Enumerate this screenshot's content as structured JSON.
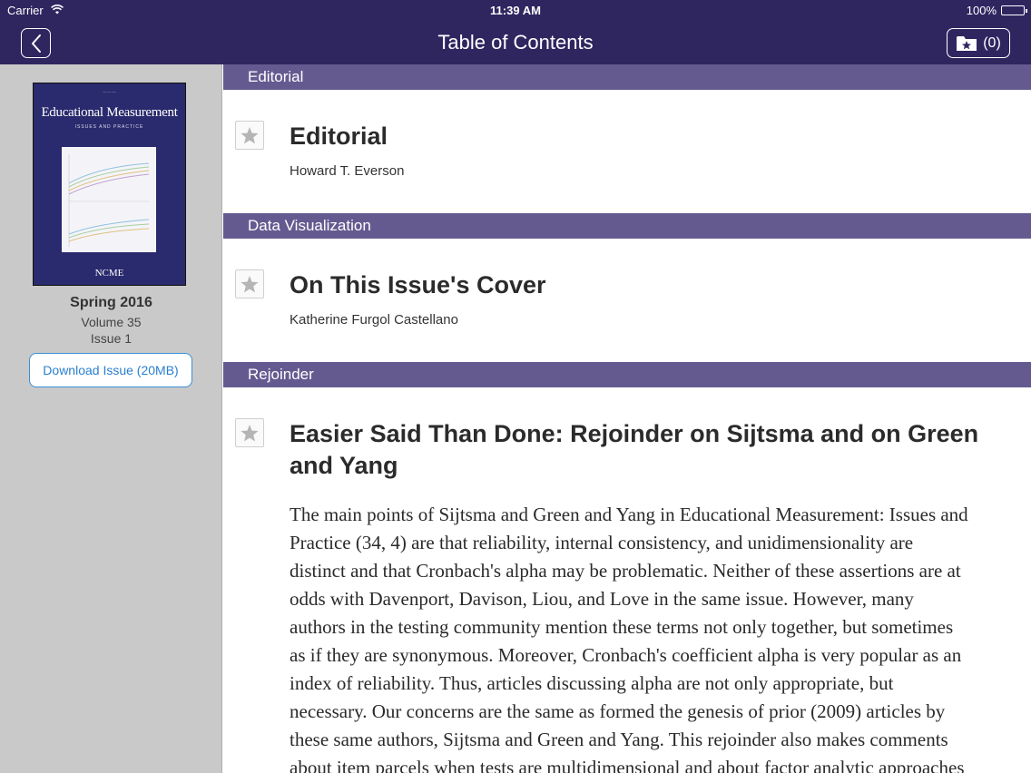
{
  "status_bar": {
    "carrier": "Carrier",
    "time": "11:39 AM",
    "battery": "100%"
  },
  "nav": {
    "title": "Table of Contents",
    "saved_count": "(0)"
  },
  "issue": {
    "cover": {
      "title": "Educational Measurement",
      "subtitle": "ISSUES AND PRACTICE",
      "logo": "NCME"
    },
    "season": "Spring 2016",
    "volume": "Volume 35",
    "number": "Issue 1",
    "download_label": "Download Issue (20MB)"
  },
  "sections": [
    {
      "header": "Editorial",
      "article": {
        "title": "Editorial",
        "author": "Howard T. Everson"
      }
    },
    {
      "header": "Data Visualization",
      "article": {
        "title": "On This Issue's Cover",
        "author": "Katherine Furgol Castellano"
      }
    },
    {
      "header": "Rejoinder",
      "article": {
        "title_line1": "Easier Said Than Done: Rejoinder on Sijtsma and on Green",
        "title_line2": "and Yang",
        "abstract": [
          "The main points of Sijtsma and Green and Yang in Educational Measurement: Issues and",
          "Practice (34, 4) are that reliability, internal consistency, and unidimensionality are",
          "distinct and that Cronbach's alpha may be problematic. Neither of these assertions are at",
          "odds with Davenport, Davison, Liou, and Love in the same issue. However, many",
          "authors in the testing community mention these terms not only together, but sometimes",
          "as if they are synonymous. Moreover, Cronbach's coefficient alpha is very popular as an",
          "index of reliability. Thus, articles discussing alpha are not only appropriate, but",
          "necessary. Our concerns are the same as formed the genesis of prior (2009) articles by",
          "these same authors, Sijtsma and Green and Yang. This rejoinder also makes comments",
          "about item parcels when tests are multidimensional and about factor analytic approaches"
        ]
      }
    }
  ]
}
